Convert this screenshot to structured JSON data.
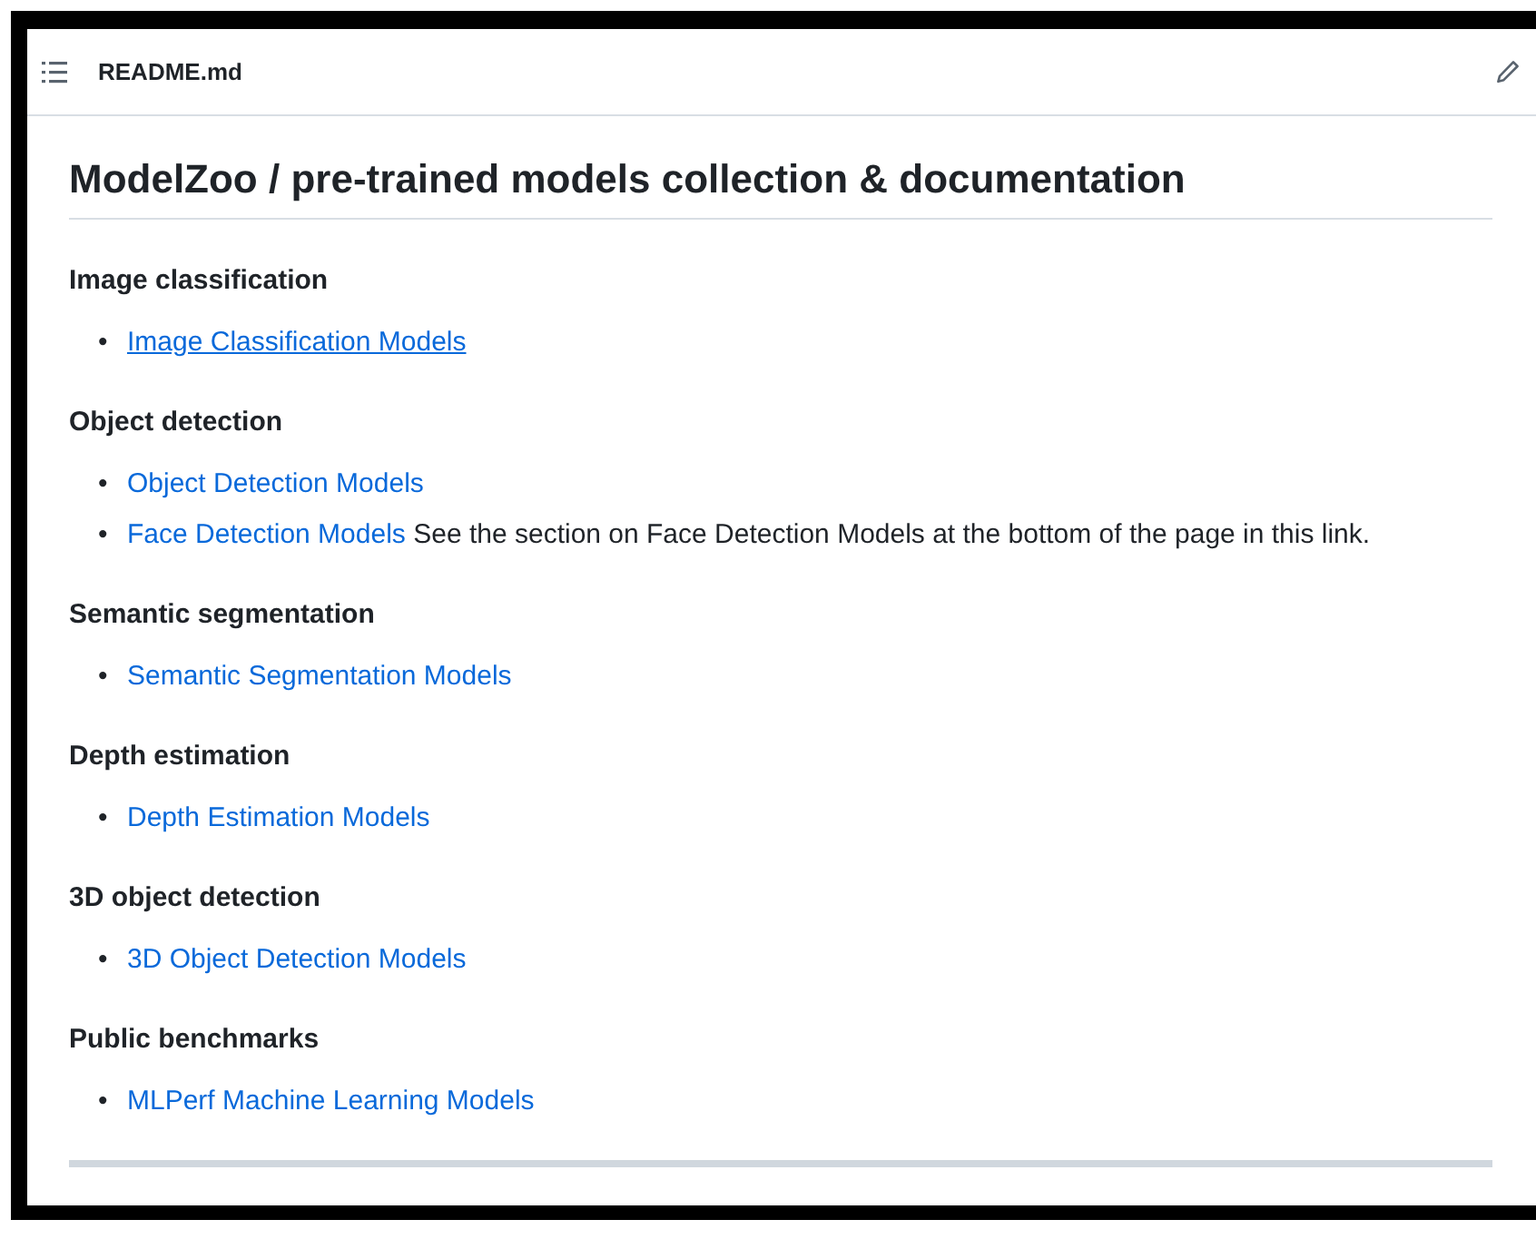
{
  "header": {
    "filename": "README.md"
  },
  "title": "ModelZoo / pre-trained models collection & documentation",
  "sections": [
    {
      "heading": "Image classification",
      "items": [
        {
          "bullet": "•",
          "link": "Image Classification Models",
          "hovered": true
        }
      ]
    },
    {
      "heading": "Object detection",
      "items": [
        {
          "bullet": "•",
          "link": "Object Detection Models",
          "hovered": false
        },
        {
          "bullet": "•",
          "link": "Face Detection Models",
          "hovered": false,
          "note": "See the section on Face Detection Models at the bottom of the page in this link."
        }
      ]
    },
    {
      "heading": "Semantic segmentation",
      "items": [
        {
          "bullet": "•",
          "link": "Semantic Segmentation Models",
          "hovered": false
        }
      ]
    },
    {
      "heading": "Depth estimation",
      "items": [
        {
          "bullet": "•",
          "link": "Depth Estimation Models",
          "hovered": false
        }
      ]
    },
    {
      "heading": "3D object detection",
      "items": [
        {
          "bullet": "•",
          "link": "3D Object Detection Models",
          "hovered": false
        }
      ]
    },
    {
      "heading": "Public benchmarks",
      "items": [
        {
          "bullet": "•",
          "link": "MLPerf Machine Learning Models",
          "hovered": false
        }
      ]
    }
  ]
}
